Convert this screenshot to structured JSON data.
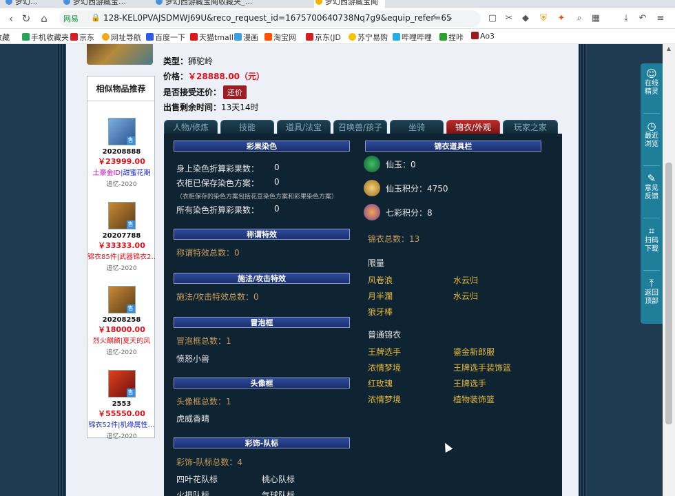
{
  "browser": {
    "tabs": [
      "梦幻…",
      "梦幻西游藏宝…",
      "梦幻西游藏宝阁收藏夹_…",
      "梦幻西游藏宝阁"
    ],
    "address": {
      "site_label": "网易",
      "url": "128-KEL0PVAJSDMWJ69U&reco_request_id=1675700640738Nq7g9&equip_refer=65"
    },
    "bookmarks": [
      "收藏",
      "手机收藏夹",
      "京东",
      "网址导航",
      "百度一下",
      "天猫tmall",
      "漫画",
      "淘宝网",
      "京东(JD",
      "苏宁易购",
      "哔哩哔哩",
      "捏咔",
      "Ao3"
    ]
  },
  "item_info": {
    "type_label": "类型：",
    "type_value": "狮驼岭",
    "price_label": "价格：",
    "price_value": "￥28888.00（元）",
    "haggle_label": "是否接受还价：",
    "haggle_button": "还价",
    "time_label": "出售剩余时间：",
    "time_value": "13天14时"
  },
  "similar": {
    "title": "相似物品推荐",
    "items": [
      {
        "id": "20208888",
        "price": "￥23999.00",
        "tag1": "土豪金ID",
        "tag2": "|甜蜜花期",
        "server": "追忆-2020",
        "sell": "售"
      },
      {
        "id": "20207788",
        "price": "￥33333.00",
        "tag1": "锦衣85件",
        "tag2": "|武器锦衣2…",
        "server": "追忆-2020",
        "sell": "售"
      },
      {
        "id": "20208258",
        "price": "￥18000.00",
        "tag1": "烈火麒麟",
        "tag2": "|夏天的风",
        "server": "追忆-2020",
        "sell": "售"
      },
      {
        "id": "2553",
        "price": "￥55550.00",
        "tag1": "锦衣52件",
        "tag2": "|机缘属性…",
        "server": "追忆-2020",
        "sell": "售"
      }
    ]
  },
  "tabs": [
    "人物/修炼",
    "技能",
    "道具/法宝",
    "召唤兽/孩子",
    "坐骑",
    "锦衣/外观",
    "玩家之家"
  ],
  "left_col": {
    "dye_title": "彩果染色",
    "dye_rows": [
      {
        "label": "身上染色折算彩果数：",
        "value": "0"
      },
      {
        "label": "衣柜已保存染色方案：",
        "value": "0"
      },
      {
        "label": "所有染色折算彩果数：",
        "value": "0"
      }
    ],
    "dye_note": "（衣柜保存的染色方案包括花豆染色方案和彩果染色方案）",
    "title_section": "称谓特效",
    "title_total": "称谓特效总数：0",
    "spell_section": "施法/攻击特效",
    "spell_total": "施法/攻击特效总数：0",
    "bubble_section": "冒泡框",
    "bubble_total": "冒泡框总数：1",
    "bubble_item": "愤怒小兽",
    "avatar_section": "头像框",
    "avatar_total": "头像框总数：1",
    "avatar_item": "虎威香晴",
    "flag_section": "彩饰-队标",
    "flag_total": "彩饰-队标总数：4",
    "flag_items": [
      "四叶花队标",
      "桃心队标",
      "火把队标",
      "气球队标"
    ]
  },
  "right_col": {
    "title": "锦衣道具栏",
    "xianyu": "仙玉：0",
    "xianyu_points": "仙玉积分：4750",
    "qicai_points": "七彩积分：8",
    "total": "锦衣总数：13",
    "limited_title": "限量",
    "limited_items": [
      "风卷浪",
      "水云归",
      "月半瀾",
      "水云归",
      "狼牙棒"
    ],
    "normal_title": "普通锦衣",
    "normal_items": [
      "王牌选手",
      "鎏金新郎服",
      "浓情梦境",
      "王牌选手装饰篮",
      "红玫瑰",
      "王牌选手",
      "浓情梦境",
      "植物装饰篮"
    ]
  },
  "right_sidebar": [
    {
      "line1": "在线",
      "line2": "精灵"
    },
    {
      "line1": "最近",
      "line2": "浏览"
    },
    {
      "line1": "意见",
      "line2": "反馈"
    },
    {
      "line1": "扫码",
      "line2": "下载"
    },
    {
      "line1": "返回",
      "line2": "顶部"
    }
  ]
}
